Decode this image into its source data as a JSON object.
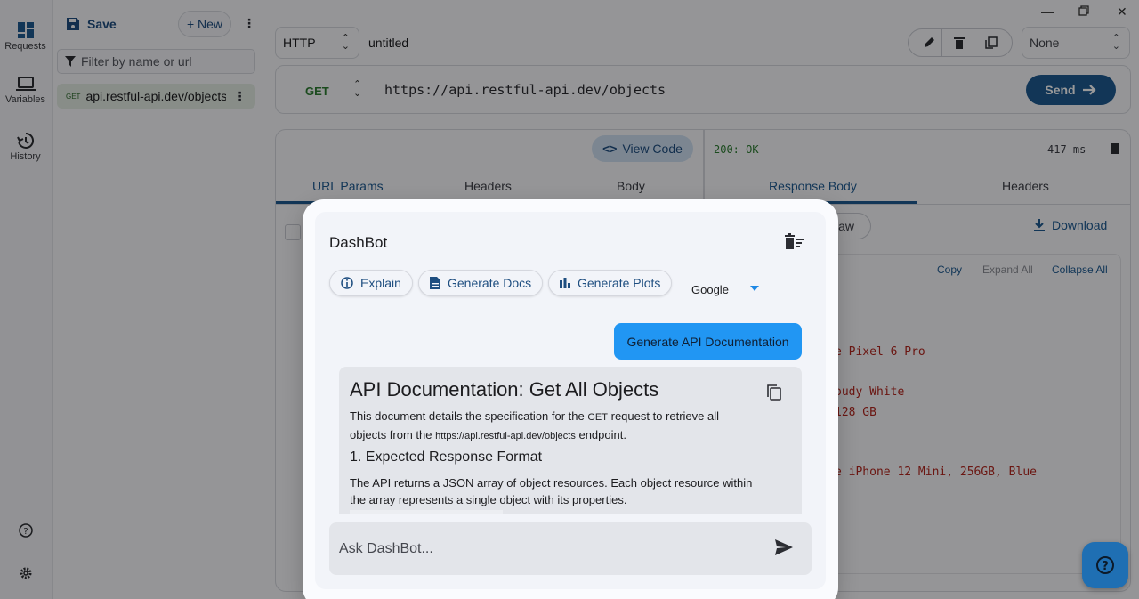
{
  "rail": {
    "requests": "Requests",
    "variables": "Variables",
    "history": "History"
  },
  "sidebar": {
    "save_label": "Save",
    "new_label": "+ New",
    "filter_placeholder": "Filter by name or url",
    "items": [
      {
        "method": "GET",
        "url": "api.restful-api.dev/objects"
      }
    ]
  },
  "topbar": {
    "protocol": "HTTP",
    "request_name": "untitled",
    "environment": "None"
  },
  "url_bar": {
    "method": "GET",
    "url": "https://api.restful-api.dev/objects",
    "send_label": "Send"
  },
  "request_pane": {
    "view_code_label": "View Code",
    "tabs": [
      "URL Params",
      "Headers",
      "Body"
    ]
  },
  "response_pane": {
    "status": "200: OK",
    "time": "417 ms",
    "tabs": [
      "Response Body",
      "Headers"
    ],
    "raw_label": "aw",
    "download_label": "Download",
    "actions": {
      "copy": "Copy",
      "expand_all": "Expand All",
      "collapse_all": "Collapse All"
    },
    "visible_fragments": [
      "e Pixel 6 Pro",
      "oudy White",
      " 128 GB",
      "e iPhone 12 Mini, 256GB, Blue"
    ]
  },
  "dashbot": {
    "title": "DashBot",
    "chips": {
      "explain": "Explain",
      "generate_docs": "Generate Docs",
      "generate_plots": "Generate Plots"
    },
    "provider": "Google",
    "user_message": "Generate API Documentation",
    "bot_message": {
      "heading": "API Documentation: Get All Objects",
      "para1_a": "This document details the specification for the ",
      "para1_method": "GET",
      "para1_b": " request to retrieve all objects from the ",
      "para1_url": "https://api.restful-api.dev/objects",
      "para1_c": " endpoint.",
      "subheading": "1. Expected Response Format",
      "para2": "The API returns a JSON array of object resources. Each object resource within the array represents a single object with its properties."
    },
    "ask_placeholder": "Ask DashBot..."
  },
  "colors": {
    "accent": "#1e5a92",
    "user_bubble": "#2196f3",
    "success": "#2e7d32",
    "json_value": "#b3261e"
  }
}
